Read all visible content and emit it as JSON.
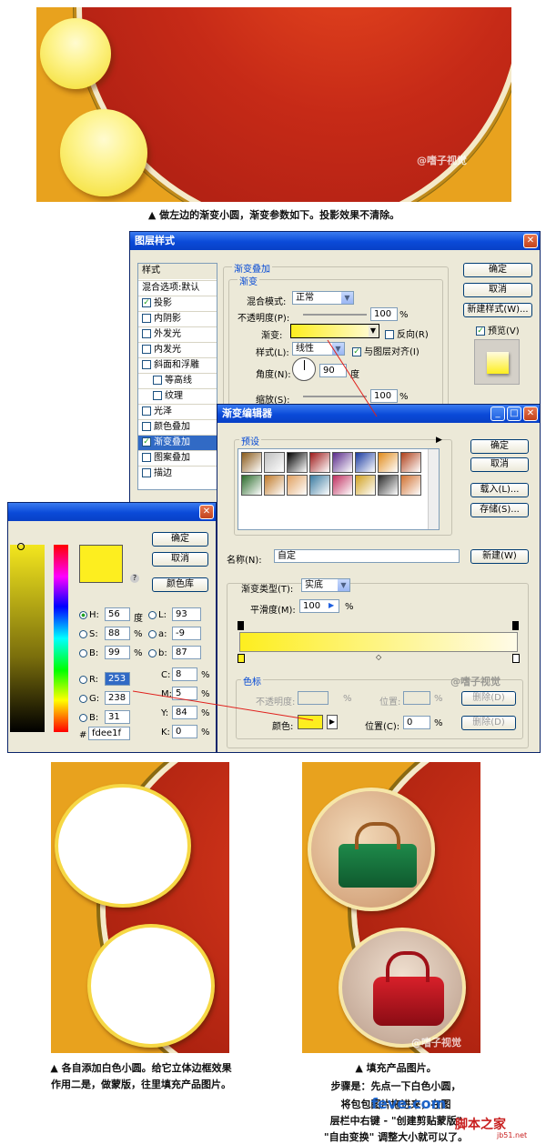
{
  "captions": {
    "top": "▲ 做左边的渐变小圆，渐变参数如下。投影效果不清除。",
    "left_1": "▲ 各自添加白色小圆。给它立体边框效果",
    "left_2": "作用二是，做蒙版，往里填充产品图片。",
    "right_1": "▲ 填充产品图片。",
    "right_2": "步骤是：先点一下白色小圆，",
    "right_3": "将包包图片拖进来，在图",
    "right_4": "层栏中右键 - \"创建剪贴蒙版\"",
    "right_5": "\"自由变换\" 调整大小就可以了。"
  },
  "watermark": "@嗜子视觉",
  "site_marks": {
    "a": "feve.com",
    "b": "脚本之家",
    "c": "jb51.net"
  },
  "layer_style": {
    "title": "图层样式",
    "sidebar_header": "样式",
    "sidebar_items": [
      {
        "label": "混合选项:默认",
        "checked": null
      },
      {
        "label": "投影",
        "checked": true
      },
      {
        "label": "内阴影",
        "checked": false
      },
      {
        "label": "外发光",
        "checked": false
      },
      {
        "label": "内发光",
        "checked": false
      },
      {
        "label": "斜面和浮雕",
        "checked": false
      },
      {
        "label": "等高线",
        "checked": false
      },
      {
        "label": "纹理",
        "checked": false
      },
      {
        "label": "光泽",
        "checked": false
      },
      {
        "label": "颜色叠加",
        "checked": false
      },
      {
        "label": "渐变叠加",
        "checked": true
      },
      {
        "label": "图案叠加",
        "checked": false
      },
      {
        "label": "描边",
        "checked": false
      }
    ],
    "group_title": "渐变叠加",
    "sub_group": "渐变",
    "blend_mode_label": "混合模式:",
    "blend_mode": "正常",
    "opacity_label": "不透明度(P):",
    "opacity": "100",
    "gradient_label": "渐变:",
    "reverse_label": "反向(R)",
    "style_label": "样式(L):",
    "style": "线性",
    "align_label": "与图层对齐(I)",
    "angle_label": "角度(N):",
    "angle": "90",
    "angle_unit": "度",
    "scale_label": "缩放(S):",
    "scale": "100",
    "pct": "%",
    "ok": "确定",
    "cancel": "取消",
    "new_style": "新建样式(W)...",
    "preview": "预览(V)"
  },
  "gradient_editor": {
    "title": "渐变编辑器",
    "presets_label": "预设",
    "ok": "确定",
    "cancel": "取消",
    "load": "载入(L)...",
    "save": "存储(S)...",
    "name_label": "名称(N):",
    "name": "自定",
    "new_button": "新建(W)",
    "type_label": "渐变类型(T):",
    "type": "实底",
    "smooth_label": "平滑度(M):",
    "smooth": "100",
    "pct": "%",
    "stops_label": "色标",
    "stop_opacity_label": "不透明度:",
    "stop_location_label": "位置:",
    "delete": "删除(D)",
    "color_label": "颜色:",
    "location_label": "位置(C):",
    "location": "0",
    "preset_colors": [
      "#8a5a1a",
      "#bfbfbf",
      "#000000",
      "#9e1a1a",
      "#5a2a8a",
      "#1a3aa0",
      "#e08a1a",
      "#b0401a",
      "#2a6a2a",
      "#c07a2a",
      "#e0a060",
      "#3a7aa0",
      "#c03060",
      "#d0a020",
      "#2a2a2a",
      "#d07030"
    ]
  },
  "color_picker": {
    "ok": "确定",
    "cancel": "取消",
    "library": "颜色库",
    "fields": [
      {
        "label": "H:",
        "value": "56",
        "unit": "度"
      },
      {
        "label": "S:",
        "value": "88",
        "unit": "%"
      },
      {
        "label": "B:",
        "value": "99",
        "unit": "%"
      },
      {
        "label": "R:",
        "value": "253",
        "unit": ""
      },
      {
        "label": "G:",
        "value": "238",
        "unit": ""
      },
      {
        "label": "B:",
        "value": "31",
        "unit": ""
      }
    ],
    "lab": [
      {
        "label": "L:",
        "value": "93"
      },
      {
        "label": "a:",
        "value": "-9"
      },
      {
        "label": "b:",
        "value": "87"
      }
    ],
    "cmyk": [
      {
        "label": "C:",
        "value": "8",
        "unit": "%"
      },
      {
        "label": "M:",
        "value": "5",
        "unit": "%"
      },
      {
        "label": "Y:",
        "value": "84",
        "unit": "%"
      },
      {
        "label": "K:",
        "value": "0",
        "unit": "%"
      }
    ],
    "hex_label": "#",
    "hex": "fdee1f",
    "swatch": "#fdee1f"
  }
}
